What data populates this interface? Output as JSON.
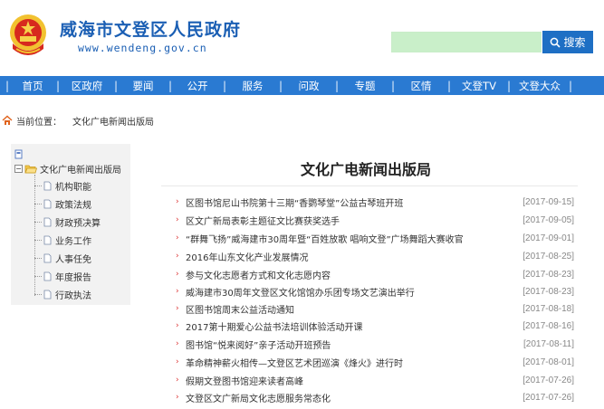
{
  "site": {
    "title": "威海市文登区人民政府",
    "url": "www.wendeng.gov.cn"
  },
  "search": {
    "placeholder": "",
    "button_label": "搜索"
  },
  "nav": {
    "items": [
      "首页",
      "区政府",
      "要闻",
      "公开",
      "服务",
      "问政",
      "专题",
      "区情",
      "文登TV",
      "文登大众"
    ]
  },
  "breadcrumb": {
    "label": "当前位置：",
    "current": "文化广电新闻出版局"
  },
  "sidebar": {
    "root": "文化广电新闻出版局",
    "items": [
      "机构职能",
      "政策法规",
      "财政预决算",
      "业务工作",
      "人事任免",
      "年度报告",
      "行政执法"
    ]
  },
  "main": {
    "title": "文化广电新闻出版局",
    "news": [
      {
        "title": "区图书馆尼山书院第十三期“香鹦琴堂”公益古琴班开班",
        "date": "[2017-09-15]"
      },
      {
        "title": "区文广新局表彰主题征文比赛获奖选手",
        "date": "[2017-09-05]"
      },
      {
        "title": "“群舞飞扬”威海建市30周年暨“百姓放歌 唱响文登”广场舞蹈大赛收官",
        "date": "[2017-09-01]"
      },
      {
        "title": "2016年山东文化产业发展情况",
        "date": "[2017-08-25]"
      },
      {
        "title": "参与文化志愿者方式和文化志愿内容",
        "date": "[2017-08-23]"
      },
      {
        "title": "威海建市30周年文登区文化馆馆办乐团专场文艺演出举行",
        "date": "[2017-08-23]"
      },
      {
        "title": "区图书馆周末公益活动通知",
        "date": "[2017-08-18]"
      },
      {
        "title": "2017第十期爱心公益书法培训体验活动开课",
        "date": "[2017-08-16]"
      },
      {
        "title": "图书馆“悦来阅好”亲子活动开班预告",
        "date": "[2017-08-11]"
      },
      {
        "title": "革命精神薪火相传—文登区艺术团巡演《烽火》进行时",
        "date": "[2017-08-01]"
      },
      {
        "title": "假期文登图书馆迎来读者高峰",
        "date": "[2017-07-26]"
      },
      {
        "title": "文登区文广新局文化志愿服务常态化",
        "date": "[2017-07-26]"
      }
    ]
  },
  "colors": {
    "brand_blue": "#1b5fb4",
    "nav_blue": "#2a7ad2",
    "search_green": "#c9efc9",
    "bullet_red": "#dd3333"
  }
}
